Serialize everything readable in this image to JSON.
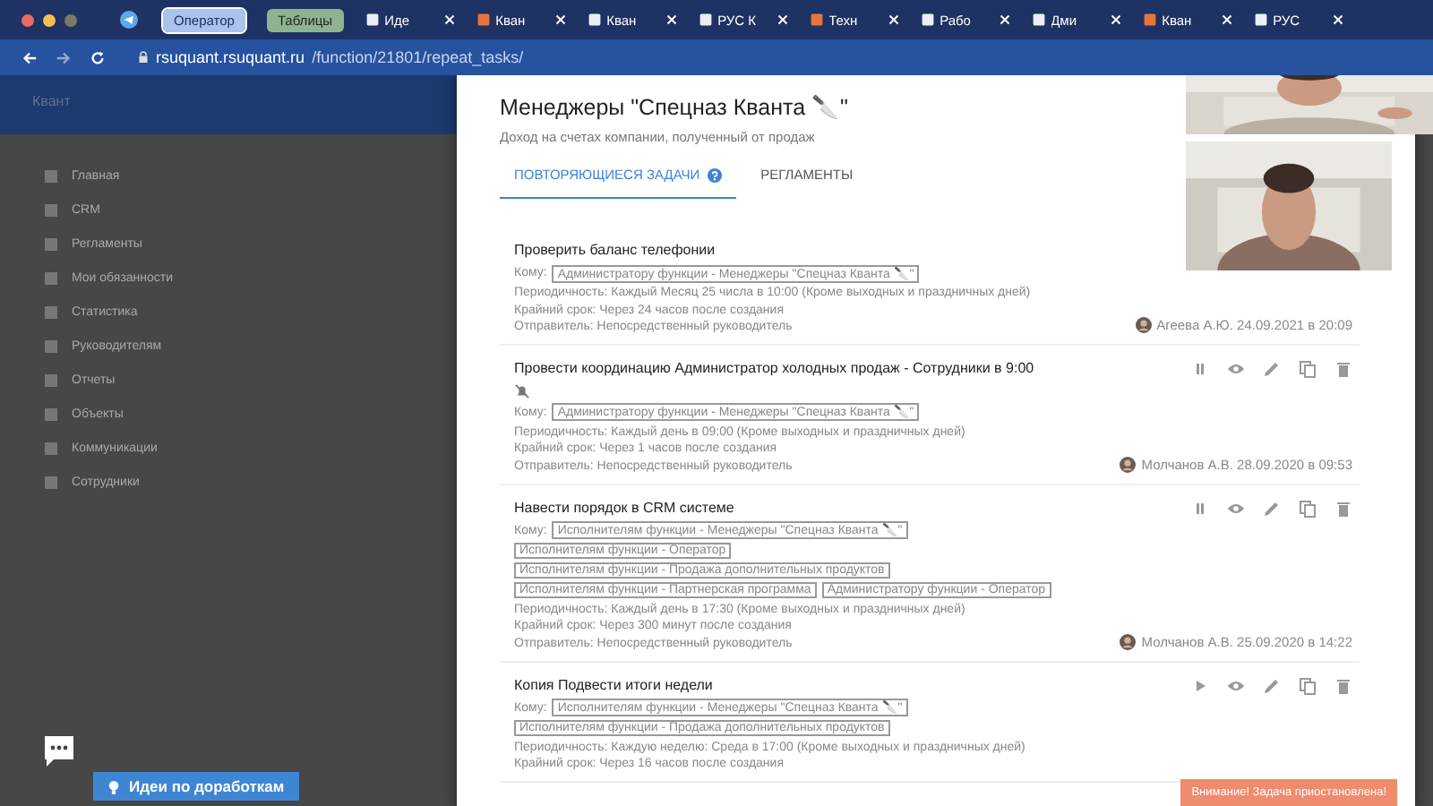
{
  "browser": {
    "tabs": [
      {
        "label": "Оператор",
        "kind": "group",
        "selected": true
      },
      {
        "label": "Таблицы",
        "kind": "group",
        "selected": false
      },
      {
        "label": "Иде",
        "kind": "page",
        "selected": false
      },
      {
        "label": "Кван",
        "kind": "page",
        "selected": false
      },
      {
        "label": "Кван",
        "kind": "page",
        "selected": false
      },
      {
        "label": "РУС К",
        "kind": "page",
        "selected": false
      },
      {
        "label": "Техн",
        "kind": "page",
        "selected": false
      },
      {
        "label": "Рабо",
        "kind": "page",
        "selected": false
      },
      {
        "label": "Дми",
        "kind": "page",
        "selected": false
      },
      {
        "label": "Кван",
        "kind": "page",
        "selected": false
      },
      {
        "label": "РУС",
        "kind": "page",
        "selected": false
      }
    ],
    "url_host": "rsuquant.rsuquant.ru",
    "url_path": "/function/21801/repeat_tasks/"
  },
  "background": {
    "title": "Квант",
    "sidebar": [
      "Главная",
      "CRM",
      "Регламенты",
      "Мои обязанности",
      "Статистика",
      "Руководителям",
      "Отчеты",
      "Объекты",
      "Коммуникации",
      "Сотрудники"
    ],
    "ideas_button": "Идеи по доработкам"
  },
  "panel": {
    "title": "Менеджеры \"Спецназ Кванта 🔪\"",
    "subtitle": "Доход на счетах компании, полученный от продаж",
    "tabs": [
      {
        "label": "ПОВТОРЯЮЩИЕСЯ ЗАДАЧИ",
        "help": true,
        "selected": true
      },
      {
        "label": "РЕГЛАМЕНТЫ",
        "help": false,
        "selected": false
      }
    ],
    "tasks": [
      {
        "title": "Проверить баланс телефонии",
        "muted": false,
        "recipients_label": "Кому:",
        "recipients": [
          "Администратору функции - Менеджеры \"Спецназ Кванта 🔪\""
        ],
        "period": "Периодичность: Каждый Месяц 25 числа в 10:00 (Кроме выходных и праздничных дней)",
        "deadline": "Крайний срок: Через 24 часов после создания",
        "sender": "Отправитель: Непосредственный руководитель",
        "author": "Агеева А.Ю. 24.09.2021 в 20:09"
      },
      {
        "title": "Провести координацию Администратор холодных продаж - Сотрудники в 9:00",
        "muted": true,
        "recipients_label": "Кому:",
        "controls": {
          "paused": false
        },
        "recipients": [
          "Администратору функции - Менеджеры \"Спецназ Кванта 🔪\""
        ],
        "period": "Периодичность: Каждый день в 09:00 (Кроме выходных и праздничных дней)",
        "deadline": "Крайний срок: Через 1 часов после создания",
        "sender": "Отправитель: Непосредственный руководитель",
        "author": "Молчанов А.В. 28.09.2020 в 09:53"
      },
      {
        "title": "Навести порядок в CRM системе",
        "muted": false,
        "recipients_label": "Кому:",
        "controls": {
          "paused": false
        },
        "recipients": [
          "Исполнителям функции - Менеджеры \"Спецназ Кванта 🔪\"",
          "Исполнителям функции - Оператор",
          "Исполнителям функции - Продажа дополнительных продуктов",
          "Исполнителям функции - Партнерская программа",
          "Администратору функции - Оператор"
        ],
        "period": "Периодичность: Каждый день в 17:30 (Кроме выходных и праздничных дней)",
        "deadline": "Крайний срок: Через 300 минут после создания",
        "sender": "Отправитель: Непосредственный руководитель",
        "author": "Молчанов А.В. 25.09.2020 в 14:22"
      },
      {
        "title": "Копия Подвести итоги недели",
        "muted": false,
        "recipients_label": "Кому:",
        "controls": {
          "paused": true
        },
        "recipients": [
          "Исполнителям функции - Менеджеры \"Спецназ Кванта 🔪\"",
          "Исполнителям функции - Продажа дополнительных продуктов"
        ],
        "period": "Периодичность: Каждую неделю: Среда в 17:00 (Кроме выходных и праздничных дней)",
        "deadline": "Крайний срок: Через 16 часов после создания"
      }
    ]
  },
  "toast": "Внимание! Задача приостановлена!"
}
